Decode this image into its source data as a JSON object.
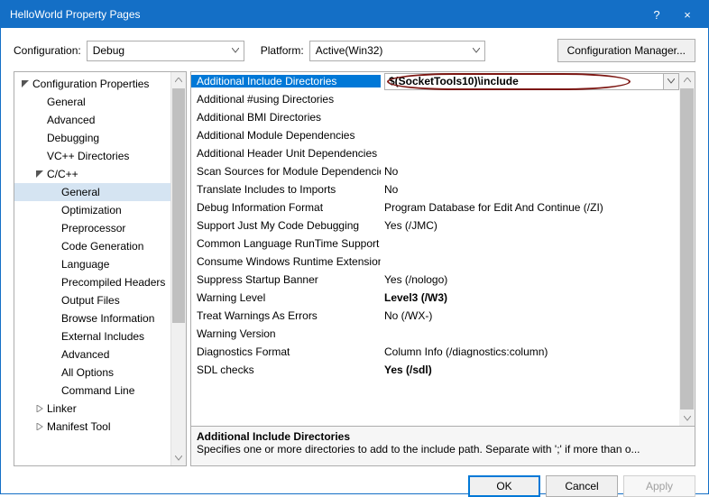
{
  "window": {
    "title": "HelloWorld Property Pages",
    "help": "?",
    "close": "×"
  },
  "topbar": {
    "config_label": "Configuration:",
    "config_value": "Debug",
    "platform_label": "Platform:",
    "platform_value": "Active(Win32)",
    "config_mgr": "Configuration Manager..."
  },
  "tree": [
    {
      "depth": 0,
      "exp": "open",
      "label": "Configuration Properties"
    },
    {
      "depth": 1,
      "exp": "",
      "label": "General"
    },
    {
      "depth": 1,
      "exp": "",
      "label": "Advanced"
    },
    {
      "depth": 1,
      "exp": "",
      "label": "Debugging"
    },
    {
      "depth": 1,
      "exp": "",
      "label": "VC++ Directories"
    },
    {
      "depth": 1,
      "exp": "open",
      "label": "C/C++"
    },
    {
      "depth": 2,
      "exp": "",
      "label": "General",
      "selected": true
    },
    {
      "depth": 2,
      "exp": "",
      "label": "Optimization"
    },
    {
      "depth": 2,
      "exp": "",
      "label": "Preprocessor"
    },
    {
      "depth": 2,
      "exp": "",
      "label": "Code Generation"
    },
    {
      "depth": 2,
      "exp": "",
      "label": "Language"
    },
    {
      "depth": 2,
      "exp": "",
      "label": "Precompiled Headers"
    },
    {
      "depth": 2,
      "exp": "",
      "label": "Output Files"
    },
    {
      "depth": 2,
      "exp": "",
      "label": "Browse Information"
    },
    {
      "depth": 2,
      "exp": "",
      "label": "External Includes"
    },
    {
      "depth": 2,
      "exp": "",
      "label": "Advanced"
    },
    {
      "depth": 2,
      "exp": "",
      "label": "All Options"
    },
    {
      "depth": 2,
      "exp": "",
      "label": "Command Line"
    },
    {
      "depth": 1,
      "exp": "closed",
      "label": "Linker"
    },
    {
      "depth": 1,
      "exp": "closed",
      "label": "Manifest Tool"
    }
  ],
  "grid": [
    {
      "label": "Additional Include Directories",
      "value": "$(SocketTools10)\\include",
      "selected": true,
      "circled": true
    },
    {
      "label": "Additional #using Directories",
      "value": ""
    },
    {
      "label": "Additional BMI Directories",
      "value": ""
    },
    {
      "label": "Additional Module Dependencies",
      "value": ""
    },
    {
      "label": "Additional Header Unit Dependencies",
      "value": ""
    },
    {
      "label": "Scan Sources for Module Dependencies",
      "value": "No"
    },
    {
      "label": "Translate Includes to Imports",
      "value": "No"
    },
    {
      "label": "Debug Information Format",
      "value": "Program Database for Edit And Continue (/ZI)"
    },
    {
      "label": "Support Just My Code Debugging",
      "value": "Yes (/JMC)"
    },
    {
      "label": "Common Language RunTime Support",
      "value": ""
    },
    {
      "label": "Consume Windows Runtime Extension",
      "value": ""
    },
    {
      "label": "Suppress Startup Banner",
      "value": "Yes (/nologo)"
    },
    {
      "label": "Warning Level",
      "value": "Level3 (/W3)",
      "bold": true
    },
    {
      "label": "Treat Warnings As Errors",
      "value": "No (/WX-)"
    },
    {
      "label": "Warning Version",
      "value": ""
    },
    {
      "label": "Diagnostics Format",
      "value": "Column Info (/diagnostics:column)"
    },
    {
      "label": "SDL checks",
      "value": "Yes (/sdl)",
      "bold": true
    }
  ],
  "desc": {
    "title": "Additional Include Directories",
    "text": "Specifies one or more directories to add to the include path. Separate with ';' if more than o..."
  },
  "buttons": {
    "ok": "OK",
    "cancel": "Cancel",
    "apply": "Apply"
  }
}
